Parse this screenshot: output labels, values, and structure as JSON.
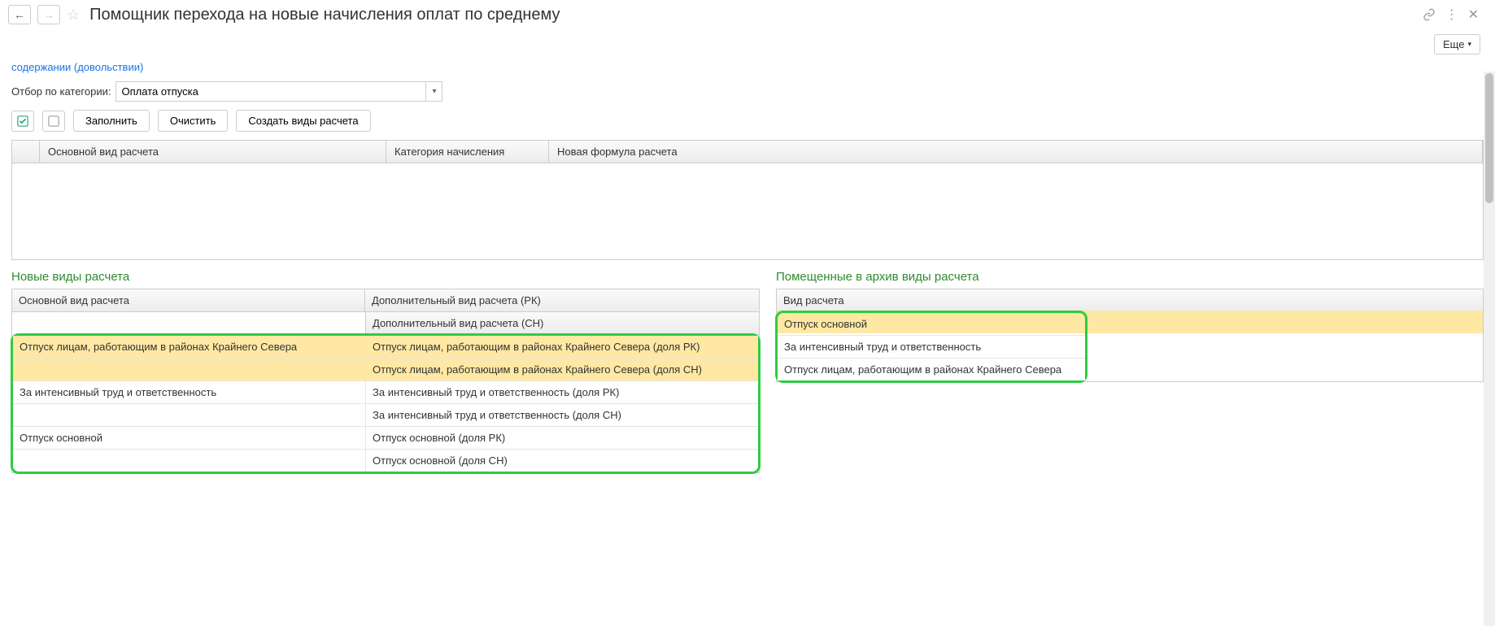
{
  "header": {
    "title": "Помощник перехода на новые начисления оплат по среднему",
    "more_label": "Еще"
  },
  "breadcrumb_tail": "содержании (довольствии)",
  "filter": {
    "label": "Отбор по категории:",
    "value": "Оплата отпуска"
  },
  "toolbar": {
    "fill": "Заполнить",
    "clear": "Очистить",
    "create": "Создать виды расчета"
  },
  "top_table": {
    "columns": [
      "Основной вид расчета",
      "Категория начисления",
      "Новая формула расчета"
    ]
  },
  "left_panel": {
    "title": "Новые виды расчета",
    "head_main": "Основной вид расчета",
    "head_add_rk": "Дополнительный вид расчета (РК)",
    "head_add_sn": "Дополнительный вид расчета (СН)",
    "rows": [
      {
        "main": "Отпуск лицам, работающим в районах Крайнего Севера",
        "rk": "Отпуск лицам, работающим в районах Крайнего Севера (доля РК)",
        "sn": "Отпуск лицам, работающим в районах Крайнего Севера (доля СН)",
        "highlight": true
      },
      {
        "main": "За интенсивный труд и ответственность",
        "rk": "За интенсивный труд и ответственность (доля РК)",
        "sn": "За интенсивный труд и ответственность (доля СН)",
        "highlight": false
      },
      {
        "main": "Отпуск основной",
        "rk": "Отпуск основной (доля РК)",
        "sn": "Отпуск основной (доля СН)",
        "highlight": false
      }
    ]
  },
  "right_panel": {
    "title": "Помещенные в архив виды расчета",
    "head": "Вид расчета",
    "rows": [
      {
        "label": "Отпуск основной",
        "highlight": true
      },
      {
        "label": "За интенсивный труд и ответственность",
        "highlight": false
      },
      {
        "label": "Отпуск лицам, работающим в районах Крайнего Севера",
        "highlight": false
      }
    ]
  }
}
